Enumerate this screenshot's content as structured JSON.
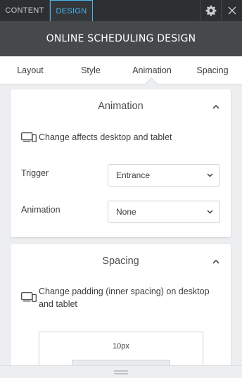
{
  "tabs": {
    "content": "CONTENT",
    "design": "DESIGN"
  },
  "title": "ONLINE SCHEDULING DESIGN",
  "subtabs": {
    "layout": "Layout",
    "style": "Style",
    "animation": "Animation",
    "spacing": "Spacing"
  },
  "animation_section": {
    "heading": "Animation",
    "note": "Change affects desktop and tablet",
    "trigger_label": "Trigger",
    "trigger_value": "Entrance",
    "animation_label": "Animation",
    "animation_value": "None"
  },
  "spacing_section": {
    "heading": "Spacing",
    "note": "Change padding (inner spacing) on desktop and tablet",
    "padding_value": "10px"
  },
  "colors": {
    "accent": "#4ab4f0",
    "topbar": "#2d2f31",
    "titlebar": "#46494c",
    "panel_bg": "#eceeef"
  },
  "icons": [
    "gear-icon",
    "close-icon",
    "chevron-up-icon",
    "chevron-down-icon",
    "devices-icon",
    "drag-handle-icon"
  ]
}
